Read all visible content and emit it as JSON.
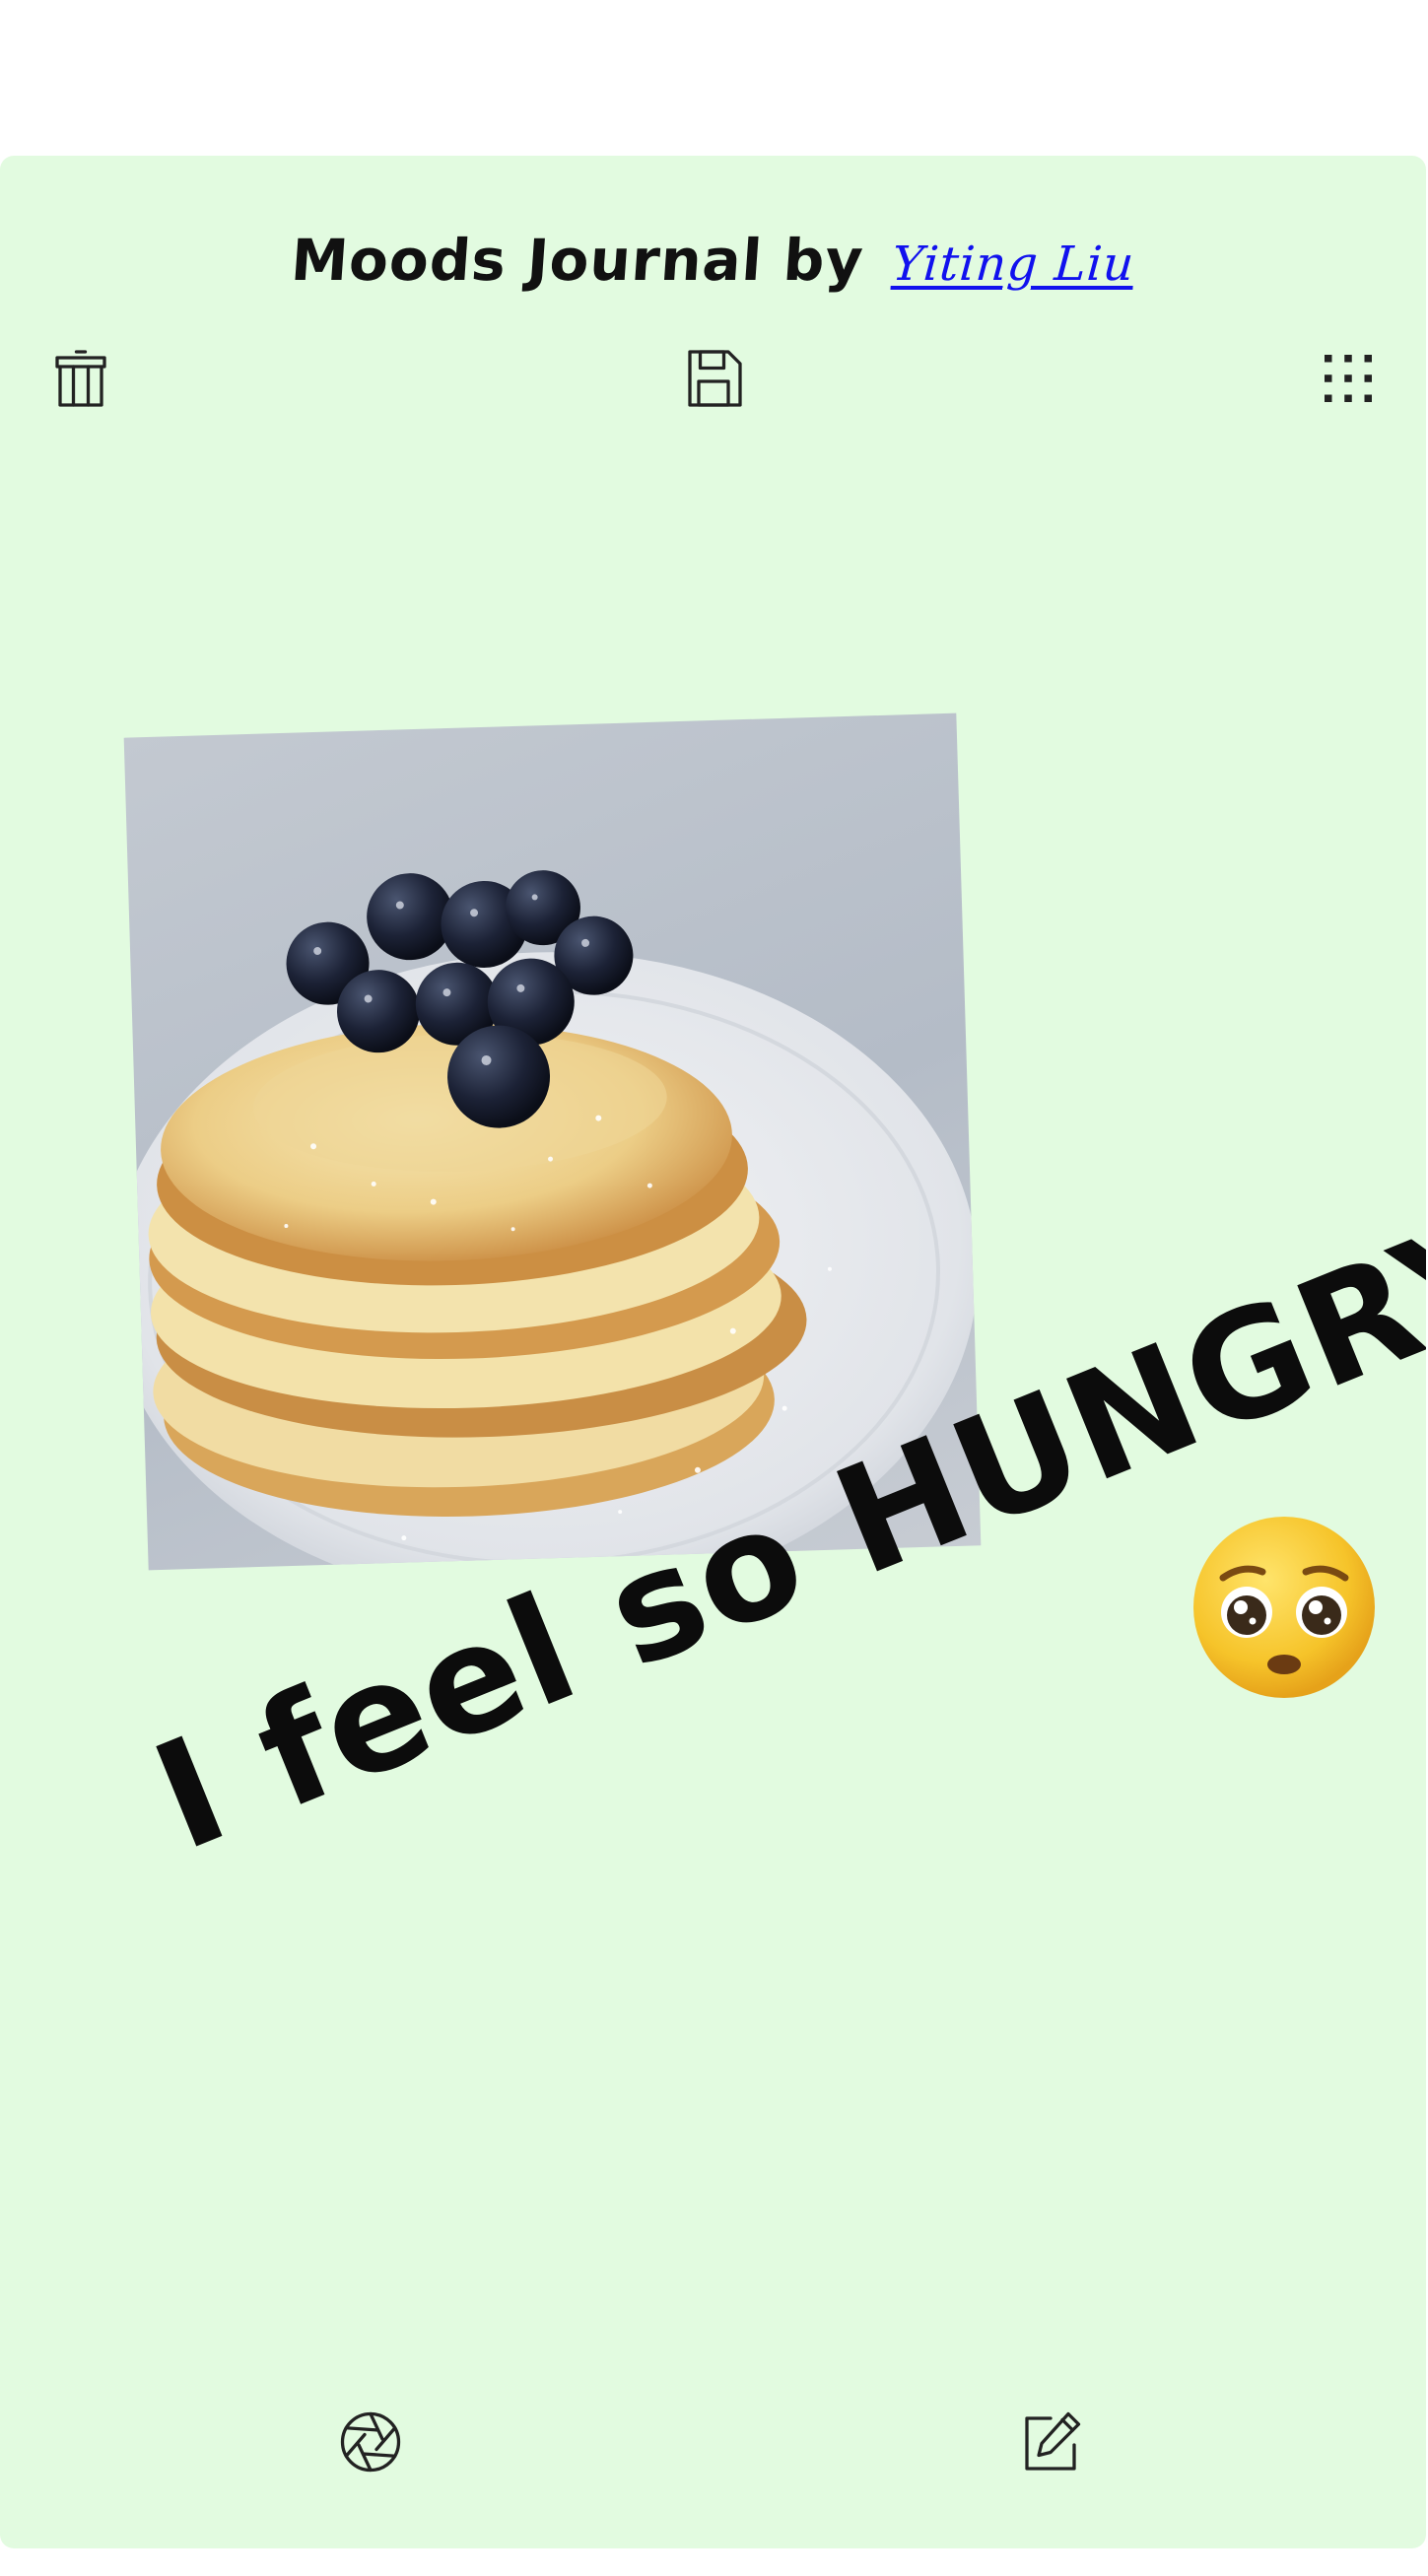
{
  "header": {
    "title_prefix": "Moods Journal by",
    "author_link": "Yiting Liu"
  },
  "toolbar": {
    "delete_icon": "trash-icon",
    "save_icon": "floppy-disk-icon",
    "menu_icon": "grid-dots-icon"
  },
  "entry": {
    "photo_subject": "stack of pancakes with blueberries",
    "caption": "I feel so HUNGRY",
    "emoji": "pleading-face-emoji"
  },
  "bottom_bar": {
    "camera_icon": "camera-aperture-icon",
    "edit_icon": "edit-note-icon"
  },
  "colors": {
    "card_background": "#e2fbe0",
    "link": "#1111ee",
    "text": "#111111"
  }
}
